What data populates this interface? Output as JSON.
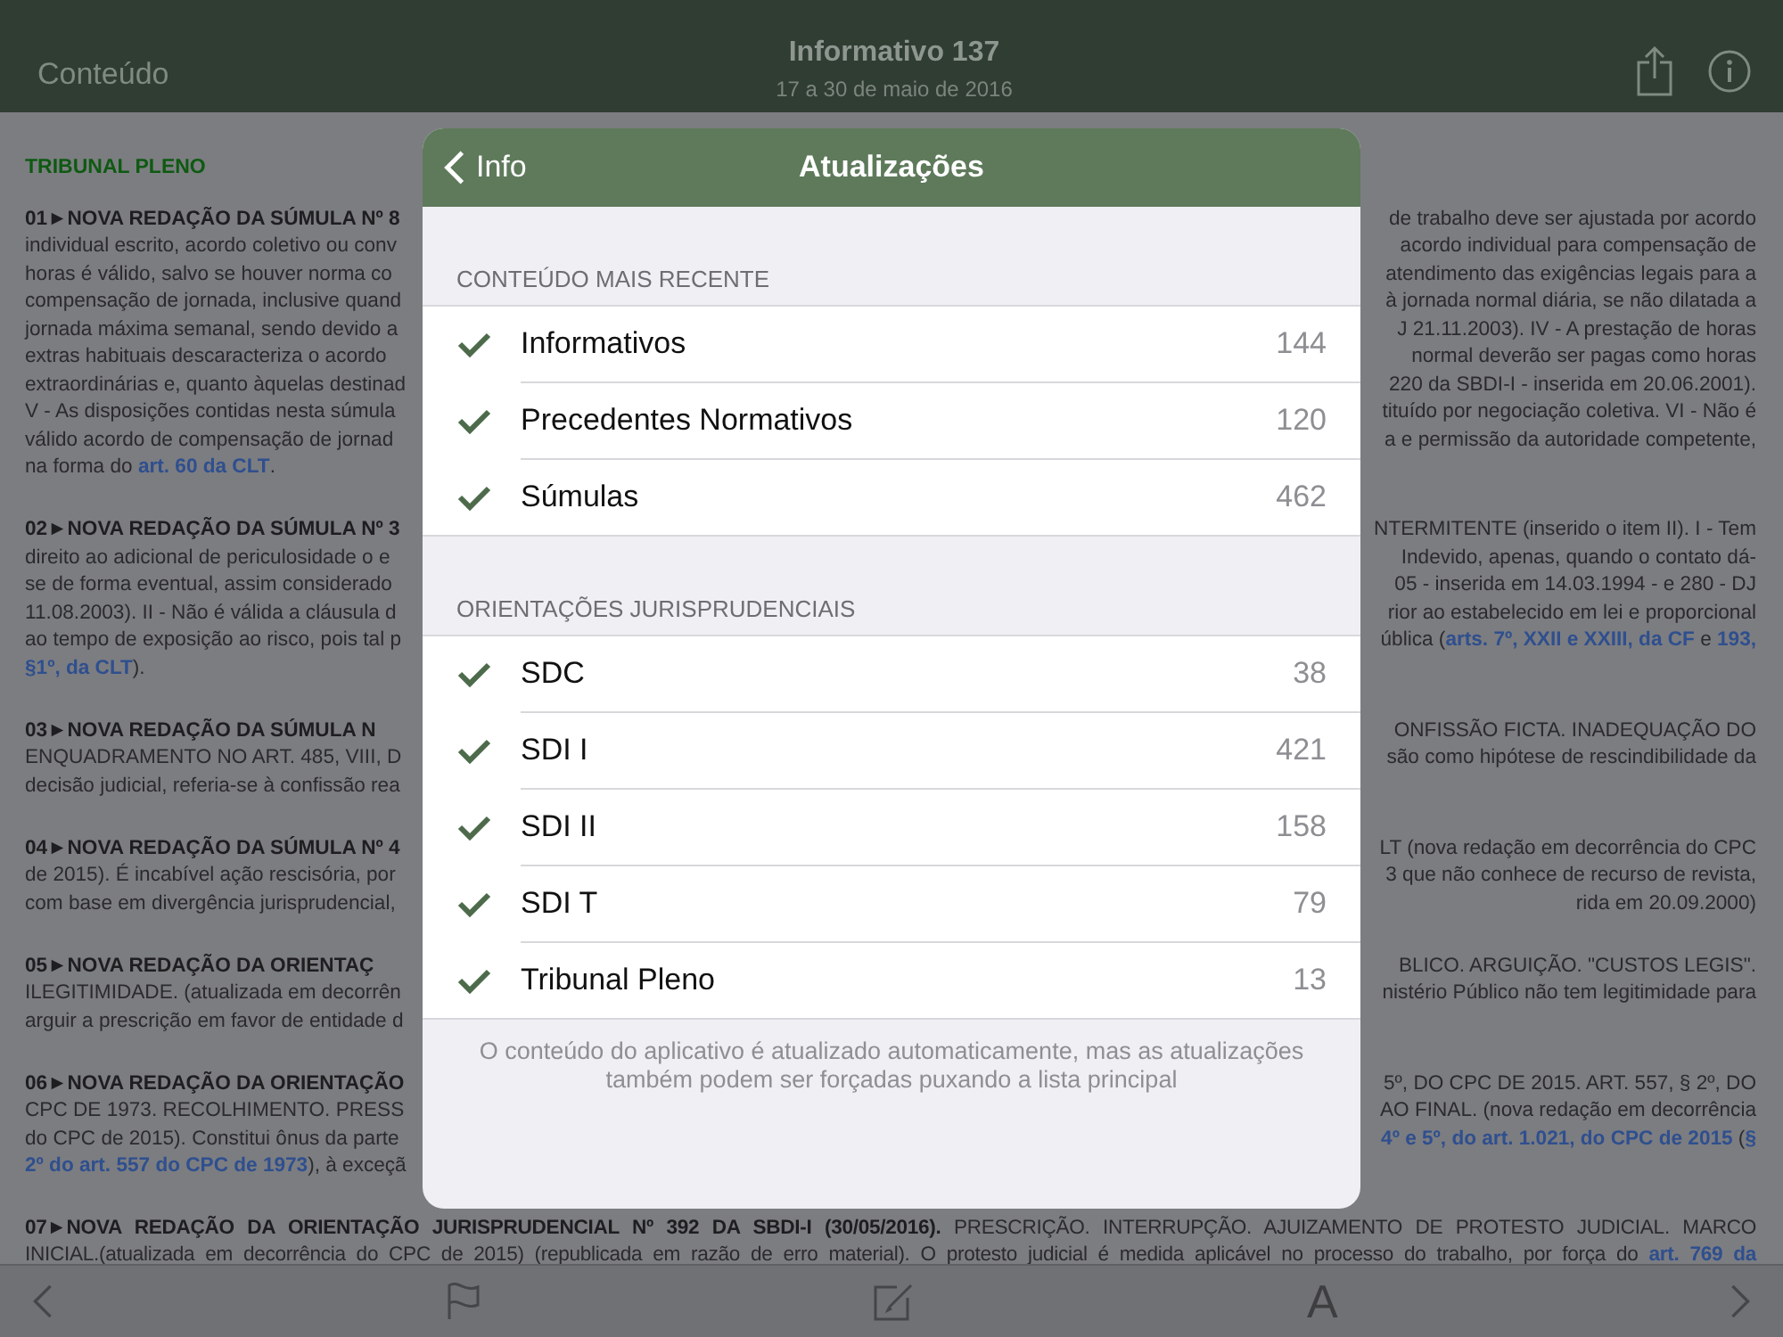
{
  "nav": {
    "back_label": "Conteúdo",
    "title": "Informativo 137",
    "subtitle": "17 a 30 de maio de 2016"
  },
  "section_title": "TRIBUNAL PLENO",
  "paragraphs": [
    {
      "kind": "split",
      "lines": [
        {
          "left": [
            {
              "kind": "bold",
              "text": "01►NOVA REDAÇÃO DA SÚMULA Nº 8"
            }
          ],
          "right": [
            {
              "kind": "plain",
              "text": "de trabalho deve ser ajustada por acordo"
            }
          ]
        },
        {
          "left": [
            {
              "kind": "plain",
              "text": "individual escrito, acordo coletivo ou conv"
            }
          ],
          "right": [
            {
              "kind": "plain",
              "text": "acordo individual para compensação de"
            }
          ]
        },
        {
          "left": [
            {
              "kind": "plain",
              "text": "horas é válido, salvo se houver norma co"
            }
          ],
          "right": [
            {
              "kind": "plain",
              "text": "atendimento das exigências legais para a"
            }
          ]
        },
        {
          "left": [
            {
              "kind": "plain",
              "text": "compensação de jornada, inclusive quand"
            }
          ],
          "right": [
            {
              "kind": "plain",
              "text": "à jornada normal diária, se não dilatada a"
            }
          ]
        },
        {
          "left": [
            {
              "kind": "plain",
              "text": "jornada máxima semanal, sendo devido a"
            }
          ],
          "right": [
            {
              "kind": "plain",
              "text": "J 21.11.2003). IV - A prestação de horas"
            }
          ]
        },
        {
          "left": [
            {
              "kind": "plain",
              "text": "extras habituais descaracteriza o acordo"
            }
          ],
          "right": [
            {
              "kind": "plain",
              "text": "normal deverão ser pagas como horas"
            }
          ]
        },
        {
          "left": [
            {
              "kind": "plain",
              "text": "extraordinárias e, quanto àquelas destinad"
            }
          ],
          "right": [
            {
              "kind": "plain",
              "text": "220 da SBDI-I - inserida em 20.06.2001)."
            }
          ]
        },
        {
          "left": [
            {
              "kind": "plain",
              "text": "V - As disposições contidas nesta súmula"
            }
          ],
          "right": [
            {
              "kind": "plain",
              "text": "tituído por negociação coletiva. VI - Não é"
            }
          ]
        },
        {
          "left": [
            {
              "kind": "plain",
              "text": "válido acordo de compensação de jornad"
            }
          ],
          "right": [
            {
              "kind": "plain",
              "text": "a e permissão da autoridade competente,"
            }
          ]
        },
        {
          "left": [
            {
              "kind": "plain",
              "text": "na forma do "
            },
            {
              "kind": "link",
              "text": "art. 60 da CLT"
            },
            {
              "kind": "plain",
              "text": "."
            }
          ]
        }
      ]
    },
    {
      "kind": "split",
      "lines": [
        {
          "left": [
            {
              "kind": "bold",
              "text": "02►NOVA REDAÇÃO DA SÚMULA Nº 3"
            }
          ],
          "right": [
            {
              "kind": "plain",
              "text": "NTERMITENTE (inserido o item II). I - Tem"
            }
          ]
        },
        {
          "left": [
            {
              "kind": "plain",
              "text": "direito ao adicional de periculosidade o e"
            }
          ],
          "right": [
            {
              "kind": "plain",
              "text": "Indevido, apenas, quando o contato dá-"
            }
          ]
        },
        {
          "left": [
            {
              "kind": "plain",
              "text": "se de forma eventual, assim considerado"
            }
          ],
          "right": [
            {
              "kind": "plain",
              "text": "05 - inserida em 14.03.1994 - e 280 - DJ"
            }
          ]
        },
        {
          "left": [
            {
              "kind": "plain",
              "text": "11.08.2003). II - Não é válida a cláusula d"
            }
          ],
          "right": [
            {
              "kind": "plain",
              "text": "rior ao estabelecido em lei e proporcional"
            }
          ]
        },
        {
          "left": [
            {
              "kind": "plain",
              "text": "ao tempo de exposição ao risco, pois tal p"
            }
          ],
          "right": [
            {
              "kind": "plain",
              "text": "ública ("
            },
            {
              "kind": "link",
              "text": "arts. 7º, XXII e XXIII, da CF"
            },
            {
              "kind": "plain",
              "text": " e "
            },
            {
              "kind": "link",
              "text": "193,"
            }
          ]
        },
        {
          "left": [
            {
              "kind": "link",
              "text": "§1º, da CLT"
            },
            {
              "kind": "plain",
              "text": ")."
            }
          ]
        }
      ]
    },
    {
      "kind": "split",
      "lines": [
        {
          "left": [
            {
              "kind": "bold",
              "text": "03►NOVA REDAÇÃO DA SÚMULA N"
            }
          ],
          "right": [
            {
              "kind": "plain",
              "text": "ONFISSÃO FICTA. INADEQUAÇÃO DO"
            }
          ]
        },
        {
          "left": [
            {
              "kind": "plain",
              "text": "ENQUADRAMENTO NO ART. 485, VIII, D"
            }
          ],
          "right": [
            {
              "kind": "plain",
              "text": "são como hipótese de rescindibilidade da"
            }
          ]
        },
        {
          "left": [
            {
              "kind": "plain",
              "text": "decisão judicial, referia-se à confissão rea"
            }
          ]
        }
      ]
    },
    {
      "kind": "split",
      "lines": [
        {
          "left": [
            {
              "kind": "bold",
              "text": "04►NOVA REDAÇÃO DA SÚMULA Nº 4"
            }
          ],
          "right": [
            {
              "kind": "plain",
              "text": "LT (nova redação em decorrência do CPC"
            }
          ]
        },
        {
          "left": [
            {
              "kind": "plain",
              "text": "de 2015). É incabível ação rescisória, por"
            }
          ],
          "right": [
            {
              "kind": "plain",
              "text": "3 que não conhece de recurso de revista,"
            }
          ]
        },
        {
          "left": [
            {
              "kind": "plain",
              "text": "com base em divergência jurisprudencial,"
            }
          ],
          "right": [
            {
              "kind": "plain",
              "text": "rida em 20.09.2000)"
            }
          ]
        }
      ]
    },
    {
      "kind": "split",
      "lines": [
        {
          "left": [
            {
              "kind": "bold",
              "text": "05►NOVA REDAÇÃO DA ORIENTAÇ"
            }
          ],
          "right": [
            {
              "kind": "plain",
              "text": "BLICO. ARGUIÇÃO. \"CUSTOS LEGIS\"."
            }
          ]
        },
        {
          "left": [
            {
              "kind": "plain",
              "text": "ILEGITIMIDADE. (atualizada em decorrên"
            }
          ],
          "right": [
            {
              "kind": "plain",
              "text": "nistério Público não tem legitimidade para"
            }
          ]
        },
        {
          "left": [
            {
              "kind": "plain",
              "text": "arguir a prescrição em favor de entidade d"
            }
          ]
        }
      ]
    },
    {
      "kind": "split",
      "lines": [
        {
          "left": [
            {
              "kind": "bold",
              "text": "06►NOVA REDAÇÃO DA ORIENTAÇÃO"
            }
          ],
          "right": [
            {
              "kind": "plain",
              "text": "5º, DO CPC DE 2015. ART. 557, § 2º, DO"
            }
          ]
        },
        {
          "left": [
            {
              "kind": "plain",
              "text": "CPC DE 1973. RECOLHIMENTO. PRESS"
            }
          ],
          "right": [
            {
              "kind": "plain",
              "text": "AO FINAL. (nova redação em decorrência"
            }
          ]
        },
        {
          "left": [
            {
              "kind": "plain",
              "text": "do CPC de 2015). Constitui ônus da parte"
            }
          ],
          "right": [
            {
              "kind": "link",
              "text": "4º e 5º, do art. 1.021, do CPC de 2015"
            },
            {
              "kind": "plain",
              "text": " ("
            },
            {
              "kind": "link",
              "text": "§"
            }
          ]
        },
        {
          "left": [
            {
              "kind": "link",
              "text": "2º do art. 557 do CPC de 1973"
            },
            {
              "kind": "plain",
              "text": "), à exceçã"
            }
          ]
        }
      ]
    },
    {
      "kind": "full",
      "lines": [
        {
          "text": [
            {
              "kind": "bold",
              "text": "07►NOVA REDAÇÃO DA ORIENTAÇÃO JURISPRUDENCIAL Nº 392 DA SBDI-I (30/05/2016)."
            },
            {
              "kind": "plain",
              "text": " PRESCRIÇÃO. INTERRUPÇÃO. AJUIZAMENTO DE PROTESTO JUDICIAL. MARCO"
            }
          ]
        },
        {
          "text": [
            {
              "kind": "plain",
              "text": "INICIAL.(atualizada em decorrência do CPC de 2015) (republicada em razão de erro material). O protesto judicial é medida aplicável no processo do trabalho, por força do "
            },
            {
              "kind": "link",
              "text": "art. 769 da"
            }
          ]
        }
      ]
    }
  ],
  "toolbar": {
    "font_button": "A"
  },
  "modal": {
    "back_label": "Info",
    "title": "Atualizações",
    "sections": [
      {
        "header": "CONTEÚDO MAIS RECENTE",
        "items": [
          {
            "label": "Informativos",
            "count": "144",
            "checked": true
          },
          {
            "label": "Precedentes Normativos",
            "count": "120",
            "checked": true
          },
          {
            "label": "Súmulas",
            "count": "462",
            "checked": true
          }
        ]
      },
      {
        "header": "ORIENTAÇÕES JURISPRUDENCIAIS",
        "items": [
          {
            "label": "SDC",
            "count": "38",
            "checked": true
          },
          {
            "label": "SDI I",
            "count": "421",
            "checked": true
          },
          {
            "label": "SDI II",
            "count": "158",
            "checked": true
          },
          {
            "label": "SDI T",
            "count": "79",
            "checked": true
          },
          {
            "label": "Tribunal Pleno",
            "count": "13",
            "checked": true
          }
        ]
      }
    ],
    "footer": "O conteúdo do aplicativo é atualizado automaticamente, mas as atualizações também podem ser forçadas puxando a lista principal"
  }
}
